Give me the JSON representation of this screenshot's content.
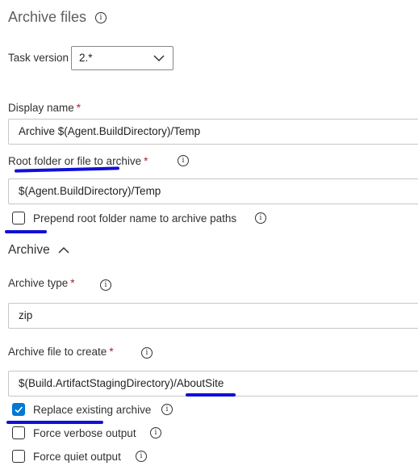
{
  "header": {
    "title": "Archive files"
  },
  "task_version": {
    "label": "Task version",
    "value": "2.*"
  },
  "display_name": {
    "label": "Display name",
    "required": "*",
    "value": "Archive $(Agent.BuildDirectory)/Temp"
  },
  "root_folder": {
    "label": "Root folder or file to archive",
    "required": "*",
    "value": "$(Agent.BuildDirectory)/Temp"
  },
  "prepend_root": {
    "label": "Prepend root folder name to archive paths",
    "checked": false
  },
  "archive_section": {
    "title": "Archive"
  },
  "archive_type": {
    "label": "Archive type",
    "required": "*",
    "value": "zip"
  },
  "archive_file": {
    "label": "Archive file to create",
    "required": "*",
    "value": "$(Build.ArtifactStagingDirectory)/AboutSite"
  },
  "options": [
    {
      "label": "Replace existing archive",
      "checked": true
    },
    {
      "label": "Force verbose output",
      "checked": false
    },
    {
      "label": "Force quiet output",
      "checked": false
    }
  ],
  "icons": {
    "info": "info-circle-icon",
    "chevron_down": "chevron-down-icon",
    "chevron_up": "chevron-up-icon",
    "checkmark": "checkmark-icon"
  },
  "colors": {
    "accent": "#0078d4",
    "required": "#a4262c",
    "annotation": "#1010d8"
  }
}
